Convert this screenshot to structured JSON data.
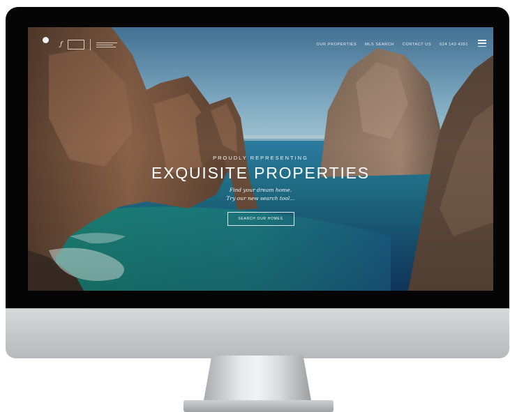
{
  "site": {
    "nav": {
      "links": [
        {
          "label": "OUR PROPERTIES"
        },
        {
          "label": "MLS SEARCH"
        },
        {
          "label": "CONTACT US"
        },
        {
          "label": "624 143 4351"
        }
      ]
    },
    "hero": {
      "eyebrow": "PROUDLY REPRESENTING",
      "title": "EXQUISITE PROPERTIES",
      "subtitle_line1": "Find your dream home.",
      "subtitle_line2": "Try our new search tool...",
      "cta_label": "SEARCH OUR HOMES"
    }
  },
  "icons": {
    "menu": "hamburger-menu-icon"
  },
  "colors": {
    "bezel": "#050505",
    "chin": "#c9cacd",
    "sky": "#6b9fbf",
    "sea": "#1d5f86",
    "rock": "#7a5a45"
  }
}
